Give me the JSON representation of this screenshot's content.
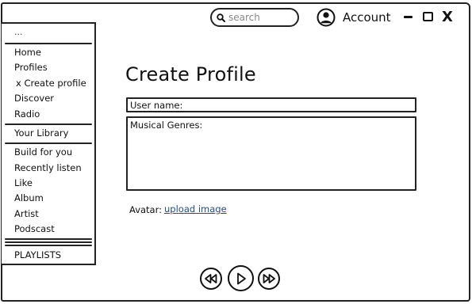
{
  "header": {
    "search_placeholder": "search",
    "account_label": "Account",
    "close_glyph": "X"
  },
  "sidebar": {
    "top_label": "...",
    "nav": [
      {
        "label": "Home"
      },
      {
        "label": "Profiles"
      },
      {
        "label": "x Create profile"
      },
      {
        "label": "Discover"
      },
      {
        "label": "Radio"
      }
    ],
    "library_label": "Your Library",
    "library_items": [
      {
        "label": "Build for you"
      },
      {
        "label": "Recently listen"
      },
      {
        "label": "Like"
      },
      {
        "label": "Album"
      },
      {
        "label": "Artist"
      },
      {
        "label": "Podscast"
      }
    ],
    "playlists_label": "PLAYLISTS"
  },
  "main": {
    "title": "Create Profile",
    "username_label": "User name:",
    "genres_label": "Musical Genres:",
    "avatar_label": "Avatar:",
    "upload_link": "upload image"
  },
  "icons": {
    "search": "search-icon",
    "account": "user-circle-icon",
    "minimize": "minimize-icon",
    "maximize": "maximize-icon",
    "close": "close-icon",
    "previous": "rewind-icon",
    "play": "play-icon",
    "next": "fast-forward-icon"
  },
  "colors": {
    "link": "#1f4f8c",
    "ink": "#222222"
  }
}
